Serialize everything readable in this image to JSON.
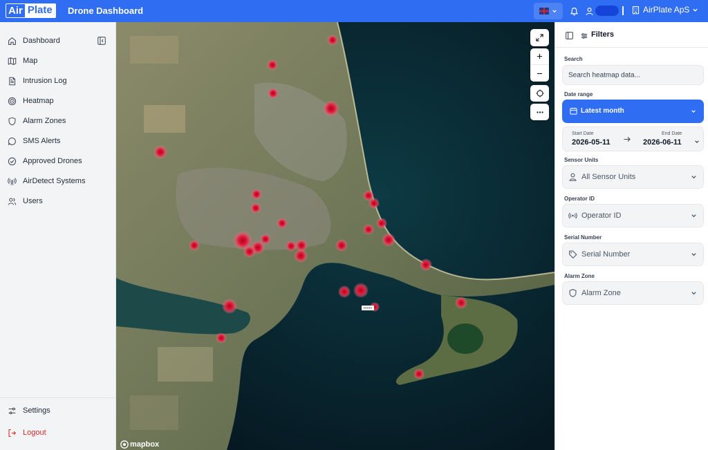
{
  "header": {
    "logo_left": "Air",
    "logo_right": "Plate",
    "title": "Drone Dashboard",
    "company": "AirPlate ApS"
  },
  "sidebar": {
    "items": [
      {
        "label": "Dashboard"
      },
      {
        "label": "Map"
      },
      {
        "label": "Intrusion Log"
      },
      {
        "label": "Heatmap"
      },
      {
        "label": "Alarm Zones"
      },
      {
        "label": "SMS Alerts"
      },
      {
        "label": "Approved Drones"
      },
      {
        "label": "AirDetect Systems"
      },
      {
        "label": "Users"
      }
    ],
    "settings": "Settings",
    "logout": "Logout"
  },
  "map": {
    "attribution": "mapbox"
  },
  "filters": {
    "title": "Filters",
    "search_label": "Search",
    "search_placeholder": "Search heatmap data...",
    "date_range_label": "Date range",
    "date_range_value": "Latest month",
    "start_label": "Start Date",
    "start_value": "2026-05-11",
    "end_label": "End Date",
    "end_value": "2026-06-11",
    "sensor_label": "Sensor Units",
    "sensor_value": "All Sensor Units",
    "operator_label": "Operator ID",
    "operator_value": "Operator ID",
    "serial_label": "Serial Number",
    "serial_value": "Serial Number",
    "alarm_label": "Alarm Zone",
    "alarm_value": "Alarm Zone"
  },
  "colors": {
    "brand": "#2f6df2",
    "heat": "#e21b3c",
    "logout": "#dc2626"
  }
}
